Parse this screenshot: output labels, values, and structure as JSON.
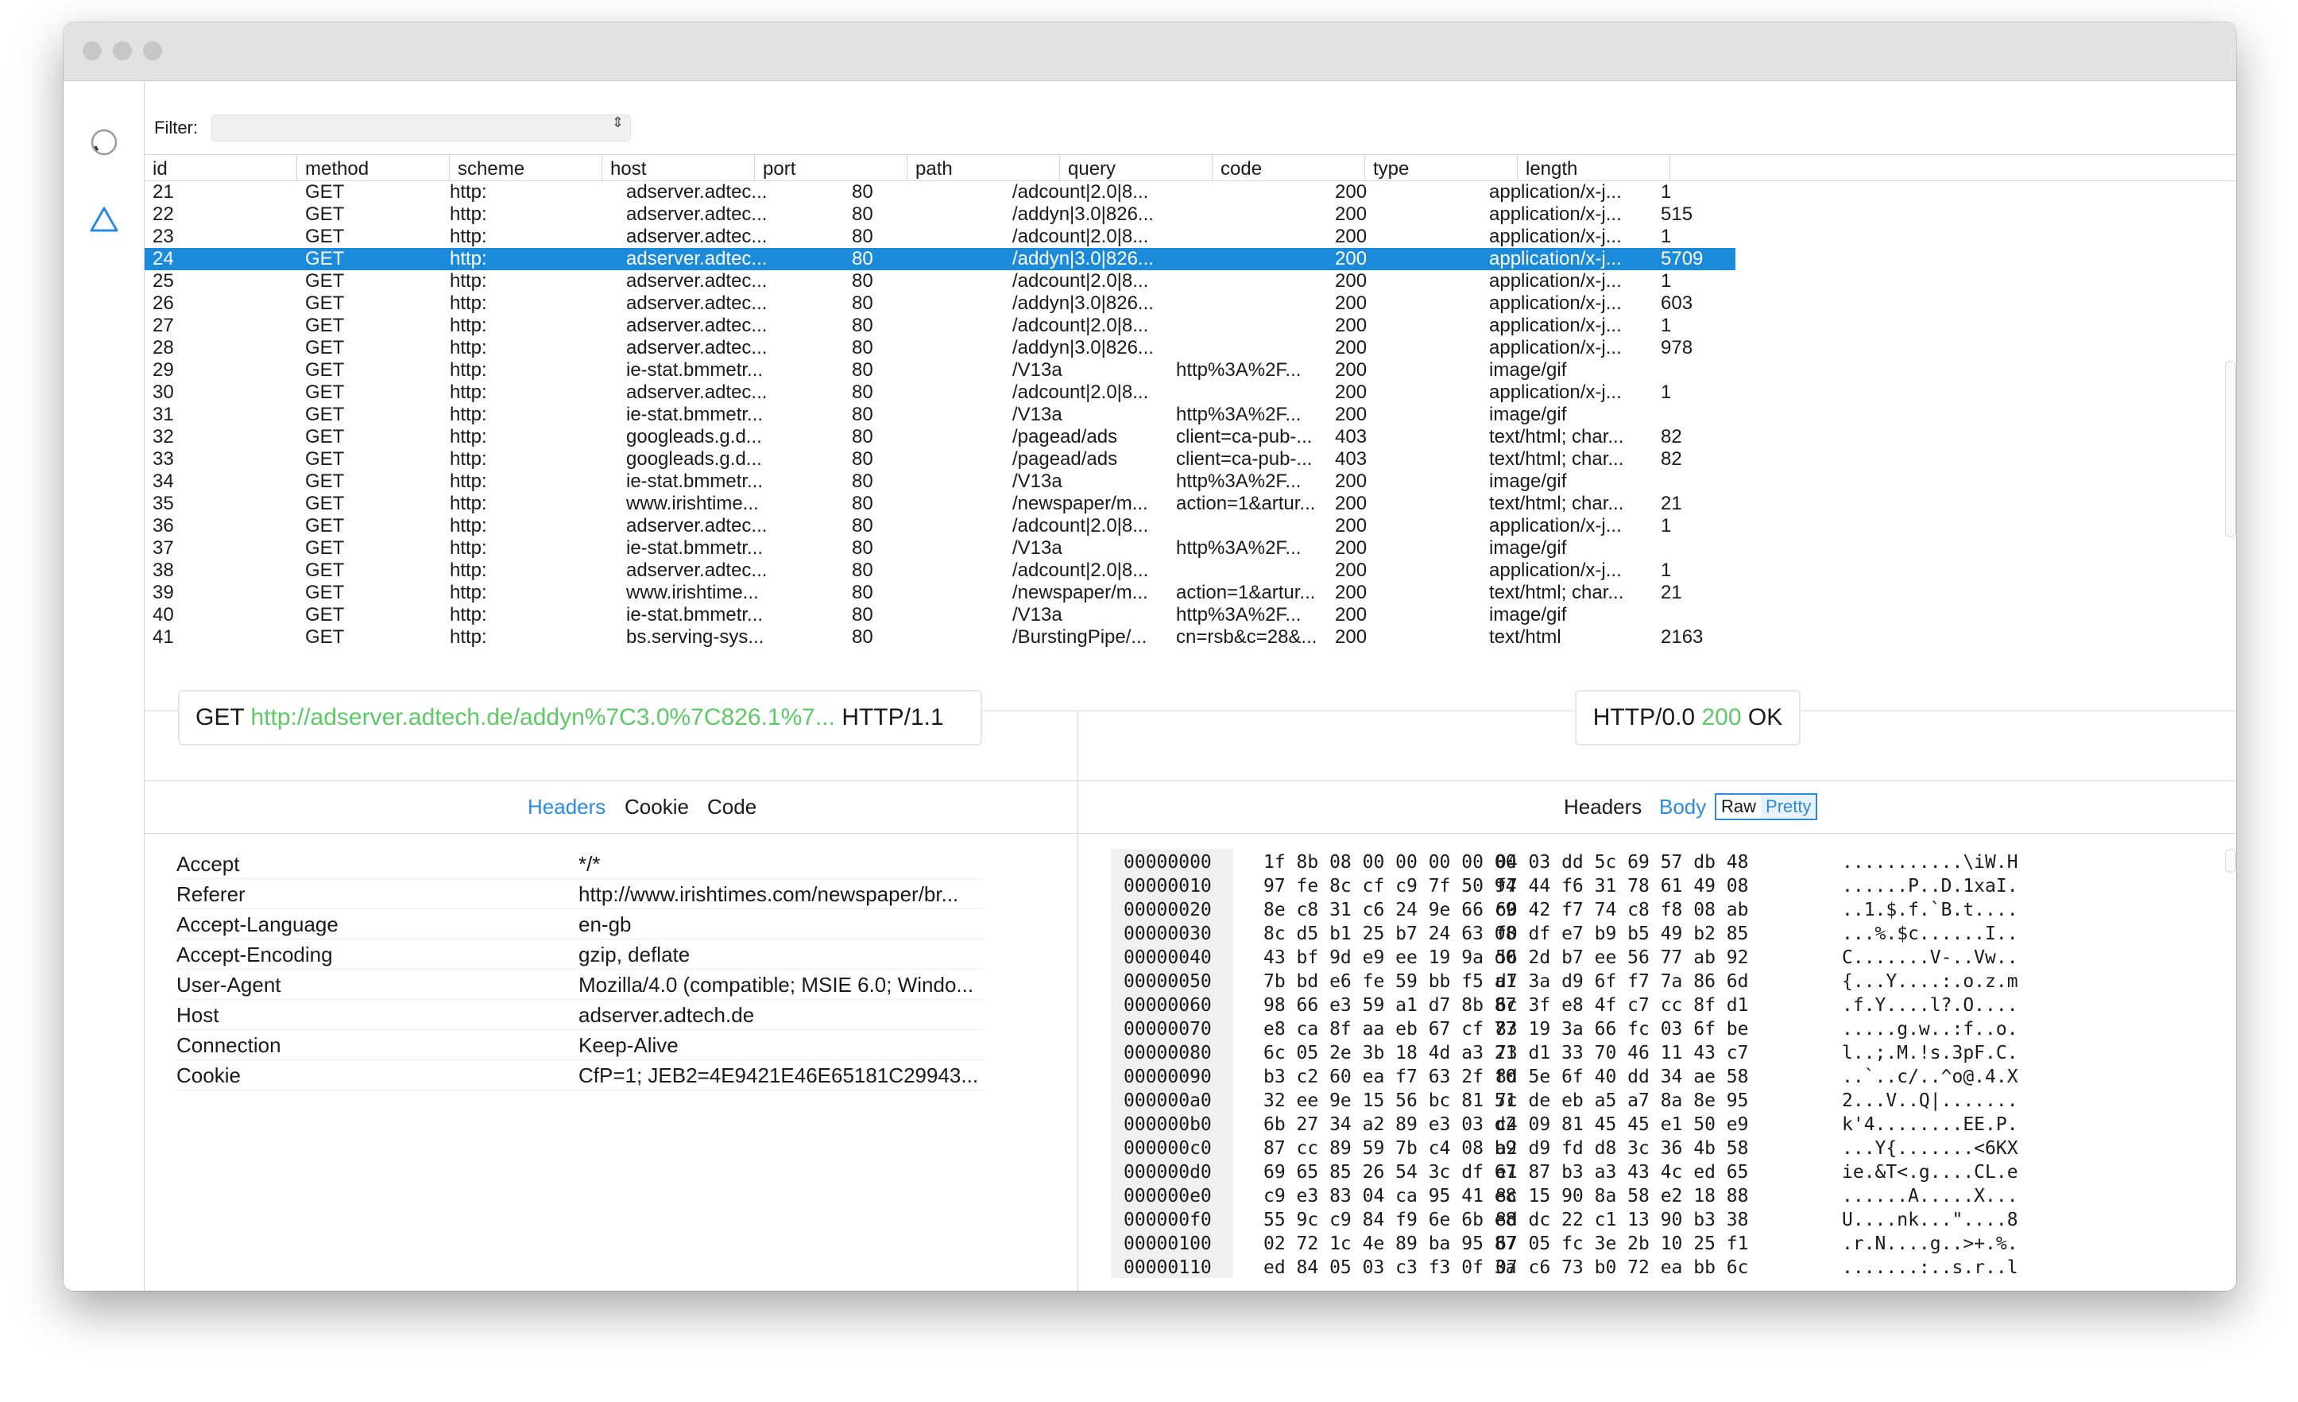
{
  "filter": {
    "label": "Filter:",
    "arrows": "⇕"
  },
  "columns": [
    "id",
    "method",
    "scheme",
    "host",
    "port",
    "path",
    "query",
    "code",
    "type",
    "length"
  ],
  "rows": [
    [
      "21",
      "GET",
      "http:",
      "adserver.adtec...",
      "80",
      "/adcount|2.0|8...",
      "",
      "200",
      "application/x-j...",
      "1"
    ],
    [
      "22",
      "GET",
      "http:",
      "adserver.adtec...",
      "80",
      "/addyn|3.0|826...",
      "",
      "200",
      "application/x-j...",
      "515"
    ],
    [
      "23",
      "GET",
      "http:",
      "adserver.adtec...",
      "80",
      "/adcount|2.0|8...",
      "",
      "200",
      "application/x-j...",
      "1"
    ],
    [
      "24",
      "GET",
      "http:",
      "adserver.adtec...",
      "80",
      "/addyn|3.0|826...",
      "",
      "200",
      "application/x-j...",
      "5709"
    ],
    [
      "25",
      "GET",
      "http:",
      "adserver.adtec...",
      "80",
      "/adcount|2.0|8...",
      "",
      "200",
      "application/x-j...",
      "1"
    ],
    [
      "26",
      "GET",
      "http:",
      "adserver.adtec...",
      "80",
      "/addyn|3.0|826...",
      "",
      "200",
      "application/x-j...",
      "603"
    ],
    [
      "27",
      "GET",
      "http:",
      "adserver.adtec...",
      "80",
      "/adcount|2.0|8...",
      "",
      "200",
      "application/x-j...",
      "1"
    ],
    [
      "28",
      "GET",
      "http:",
      "adserver.adtec...",
      "80",
      "/addyn|3.0|826...",
      "",
      "200",
      "application/x-j...",
      "978"
    ],
    [
      "29",
      "GET",
      "http:",
      "ie-stat.bmmetr...",
      "80",
      "/V13a",
      "http%3A%2F...",
      "200",
      "image/gif",
      ""
    ],
    [
      "30",
      "GET",
      "http:",
      "adserver.adtec...",
      "80",
      "/adcount|2.0|8...",
      "",
      "200",
      "application/x-j...",
      "1"
    ],
    [
      "31",
      "GET",
      "http:",
      "ie-stat.bmmetr...",
      "80",
      "/V13a",
      "http%3A%2F...",
      "200",
      "image/gif",
      ""
    ],
    [
      "32",
      "GET",
      "http:",
      "googleads.g.d...",
      "80",
      "/pagead/ads",
      "client=ca-pub-...",
      "403",
      "text/html; char...",
      "82"
    ],
    [
      "33",
      "GET",
      "http:",
      "googleads.g.d...",
      "80",
      "/pagead/ads",
      "client=ca-pub-...",
      "403",
      "text/html; char...",
      "82"
    ],
    [
      "34",
      "GET",
      "http:",
      "ie-stat.bmmetr...",
      "80",
      "/V13a",
      "http%3A%2F...",
      "200",
      "image/gif",
      ""
    ],
    [
      "35",
      "GET",
      "http:",
      "www.irishtime...",
      "80",
      "/newspaper/m...",
      "action=1&artur...",
      "200",
      "text/html; char...",
      "21"
    ],
    [
      "36",
      "GET",
      "http:",
      "adserver.adtec...",
      "80",
      "/adcount|2.0|8...",
      "",
      "200",
      "application/x-j...",
      "1"
    ],
    [
      "37",
      "GET",
      "http:",
      "ie-stat.bmmetr...",
      "80",
      "/V13a",
      "http%3A%2F...",
      "200",
      "image/gif",
      ""
    ],
    [
      "38",
      "GET",
      "http:",
      "adserver.adtec...",
      "80",
      "/adcount|2.0|8...",
      "",
      "200",
      "application/x-j...",
      "1"
    ],
    [
      "39",
      "GET",
      "http:",
      "www.irishtime...",
      "80",
      "/newspaper/m...",
      "action=1&artur...",
      "200",
      "text/html; char...",
      "21"
    ],
    [
      "40",
      "GET",
      "http:",
      "ie-stat.bmmetr...",
      "80",
      "/V13a",
      "http%3A%2F...",
      "200",
      "image/gif",
      ""
    ],
    [
      "41",
      "GET",
      "http:",
      "bs.serving-sys...",
      "80",
      "/BurstingPipe/...",
      "cn=rsb&c=28&...",
      "200",
      "text/html",
      "2163"
    ]
  ],
  "selected_row": "24",
  "request": {
    "method": "GET",
    "url": "http://adserver.adtech.de/addyn%7C3.0%7C826.1%7...",
    "version": "HTTP/1.1"
  },
  "response": {
    "version": "HTTP/0.0",
    "code": "200",
    "reason": "OK"
  },
  "request_tabs": [
    "Headers",
    "Cookie",
    "Code"
  ],
  "request_active_tab": "Headers",
  "response_tabs": [
    "Headers",
    "Body"
  ],
  "response_active_tab": "Body",
  "body_view": {
    "raw": "Raw",
    "pretty": "Pretty",
    "active": "Raw"
  },
  "request_headers": [
    [
      "Accept",
      "*/*"
    ],
    [
      "Referer",
      "http://www.irishtimes.com/newspaper/br..."
    ],
    [
      "Accept-Language",
      "en-gb"
    ],
    [
      "Accept-Encoding",
      "gzip, deflate"
    ],
    [
      "User-Agent",
      "Mozilla/4.0 (compatible; MSIE 6.0; Windo..."
    ],
    [
      "Host",
      "adserver.adtech.de"
    ],
    [
      "Connection",
      "Keep-Alive"
    ],
    [
      "Cookie",
      "CfP=1; JEB2=4E9421E46E65181C29943..."
    ]
  ],
  "hexdump": [
    [
      "00000000",
      "1f 8b 08 00 00 00 00 00",
      "04 03 dd 5c 69 57 db 48",
      "...........\\iW.H"
    ],
    [
      "00000010",
      "97 fe 8c cf c9 7f 50 94",
      "f7 44 f6 31 78 61 49 08",
      "......P..D.1xaI."
    ],
    [
      "00000020",
      "8e c8 31 c6 24 9e 66 c9",
      "60 42 f7 74 c8 f8 08 ab",
      "..1.$.f.`B.t...."
    ],
    [
      "00000030",
      "8c d5 b1 25 b7 24 63 08",
      "f0 df e7 b9 b5 49 b2 85",
      "...%.$c......I.."
    ],
    [
      "00000040",
      "43 bf 9d e9 ee 19 9a d0",
      "56 2d b7 ee 56 77 ab 92",
      "C.......V-..Vw.."
    ],
    [
      "00000050",
      "7b bd e6 fe 59 bb f5 a1",
      "d7 3a d9 6f f7 7a 86 6d",
      "{...Y....:.o.z.m"
    ],
    [
      "00000060",
      "98 66 e3 59 a1 d7 8b 87",
      "6c 3f e8 4f c7 cc 8f d1",
      ".f.Y....l?.O...."
    ],
    [
      "00000070",
      "e8 ca 8f aa eb 67 cf 77",
      "83 19 3a 66 fc 03 6f be",
      ".....g.w..:f..o."
    ],
    [
      "00000080",
      "6c 05 2e 3b 18 4d a3 21",
      "73 d1 33 70 46 11 43 c7",
      "l..;.M.!s.3pF.C."
    ],
    [
      "00000090",
      "b3 c2 60 ea f7 63 2f f0",
      "8d 5e 6f 40 dd 34 ae 58",
      "..`..c/..^o@.4.X"
    ],
    [
      "000000a0",
      "32 ee 9e 15 56 bc 81 51",
      "7c de eb a5 a7 8a 8e 95",
      "2...V..Q|......."
    ],
    [
      "000000b0",
      "6b 27 34 a2 89 e3 03 d2",
      "c4 09 81 45 45 e1 50 e9",
      "k'4........EE.P."
    ],
    [
      "000000c0",
      "87 cc 89 59 7b c4 08 b9",
      "a2 d9 fd d8 3c 36 4b 58",
      "...Y{.......<6KX"
    ],
    [
      "000000d0",
      "69 65 85 26 54 3c df 67",
      "e1 87 b3 a3 43 4c ed 65",
      "ie.&T<.g....CL.e"
    ],
    [
      "000000e0",
      "c9 e3 83 04 ca 95 41 e8",
      "8c 15 90 8a 58 e2 18 88",
      "......A.....X..."
    ],
    [
      "000000f0",
      "55 9c c9 84 f9 6e 6b e8",
      "8d dc 22 c1 13 90 b3 38",
      "U....nk...\"....8"
    ],
    [
      "00000100",
      "02 72 1c 4e 89 ba 95 87",
      "67 05 fc 3e 2b 10 25 f1",
      ".r.N....g..>+.%."
    ],
    [
      "00000110",
      "ed 84 05 03 c3 f3 0f 3a",
      "07 c6 73 b0 72 ea bb 6c",
      ".......:..s.r..l"
    ]
  ],
  "colors": {
    "selection": "#1b8ad8",
    "accent": "#2b8be0",
    "url_green": "#5dc967"
  },
  "icons": {
    "sidebar_top": "circle-spinner-icon",
    "sidebar_second": "triangle-icon",
    "window_controls": "traffic-light-icons"
  }
}
